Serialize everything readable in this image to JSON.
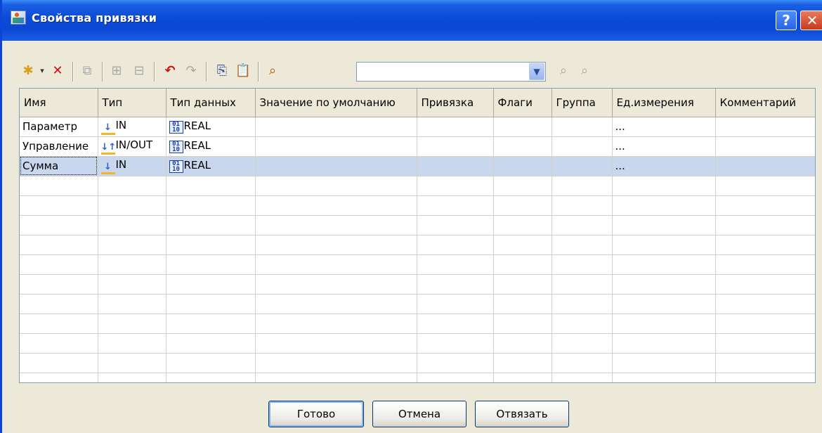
{
  "window": {
    "title": "Свойства привязки",
    "help_label": "?",
    "close_label": "✕"
  },
  "toolbar": {
    "icons": [
      "new-item-icon",
      "dropdown-arrow-icon",
      "delete-icon",
      "import-icon",
      "group-icon",
      "ungroup-icon",
      "undo-icon",
      "redo-icon",
      "copy-icon",
      "paste-icon",
      "find-icon",
      "find-next-icon",
      "find-prev-icon"
    ],
    "search_value": ""
  },
  "grid": {
    "columns": [
      "Имя",
      "Тип",
      "Тип данных",
      "Значение по умолчанию",
      "Привязка",
      "Флаги",
      "Группа",
      "Ед.измерения",
      "Комментарий"
    ],
    "rows": [
      {
        "name": "Параметр",
        "type": "IN",
        "data_type": "REAL",
        "default": "",
        "binding": "",
        "flags": "",
        "group": "",
        "unit": "...",
        "comment": ""
      },
      {
        "name": "Управление",
        "type": "IN/OUT",
        "data_type": "REAL",
        "default": "",
        "binding": "",
        "flags": "",
        "group": "",
        "unit": "...",
        "comment": ""
      },
      {
        "name": "Сумма",
        "type": "IN",
        "data_type": "REAL",
        "default": "",
        "binding": "",
        "flags": "",
        "group": "",
        "unit": "...",
        "comment": ""
      }
    ],
    "selected_row": 3
  },
  "buttons": {
    "ok_label": "Готово",
    "cancel_label": "Отмена",
    "unbind_label": "Отвязать"
  },
  "colors": {
    "titlebar": "#0a48d4",
    "selection": "#c8d6ee",
    "dialog_bg": "#ece9d8"
  }
}
